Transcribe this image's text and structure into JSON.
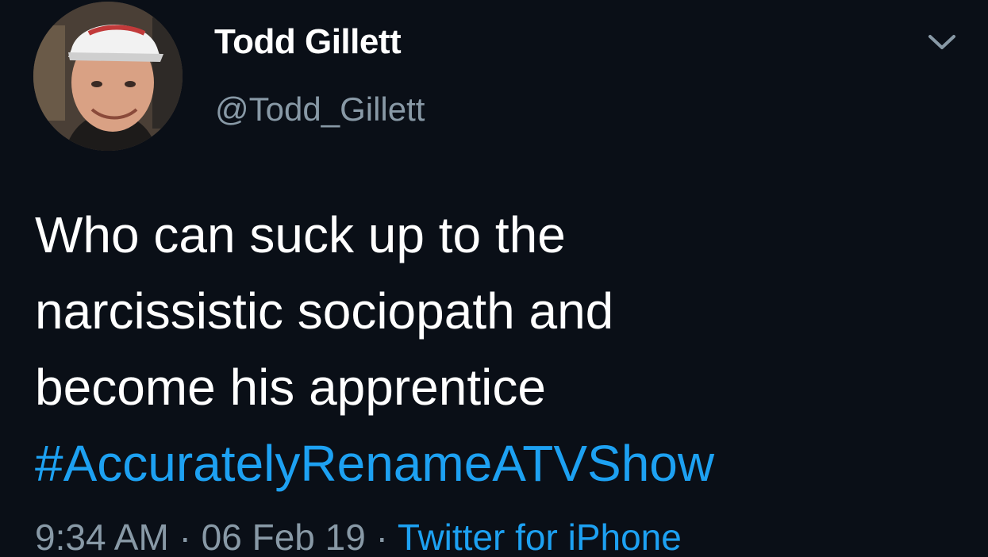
{
  "tweet": {
    "author": {
      "display_name": "Todd Gillett",
      "handle": "@Todd_Gillett",
      "avatar_icon": "profile-photo"
    },
    "body_lines": [
      "Who can suck up to the",
      "narcissistic sociopath and",
      "become his apprentice"
    ],
    "hashtag": "#AccuratelyRenameATVShow",
    "time": "9:34 AM",
    "separator": "·",
    "date": "06 Feb 19",
    "source": "Twitter for iPhone",
    "menu_icon": "chevron-down-icon"
  },
  "colors": {
    "background": "#0a0f17",
    "primary_text": "#ffffff",
    "secondary_text": "#8899a6",
    "link": "#1da1f2"
  }
}
